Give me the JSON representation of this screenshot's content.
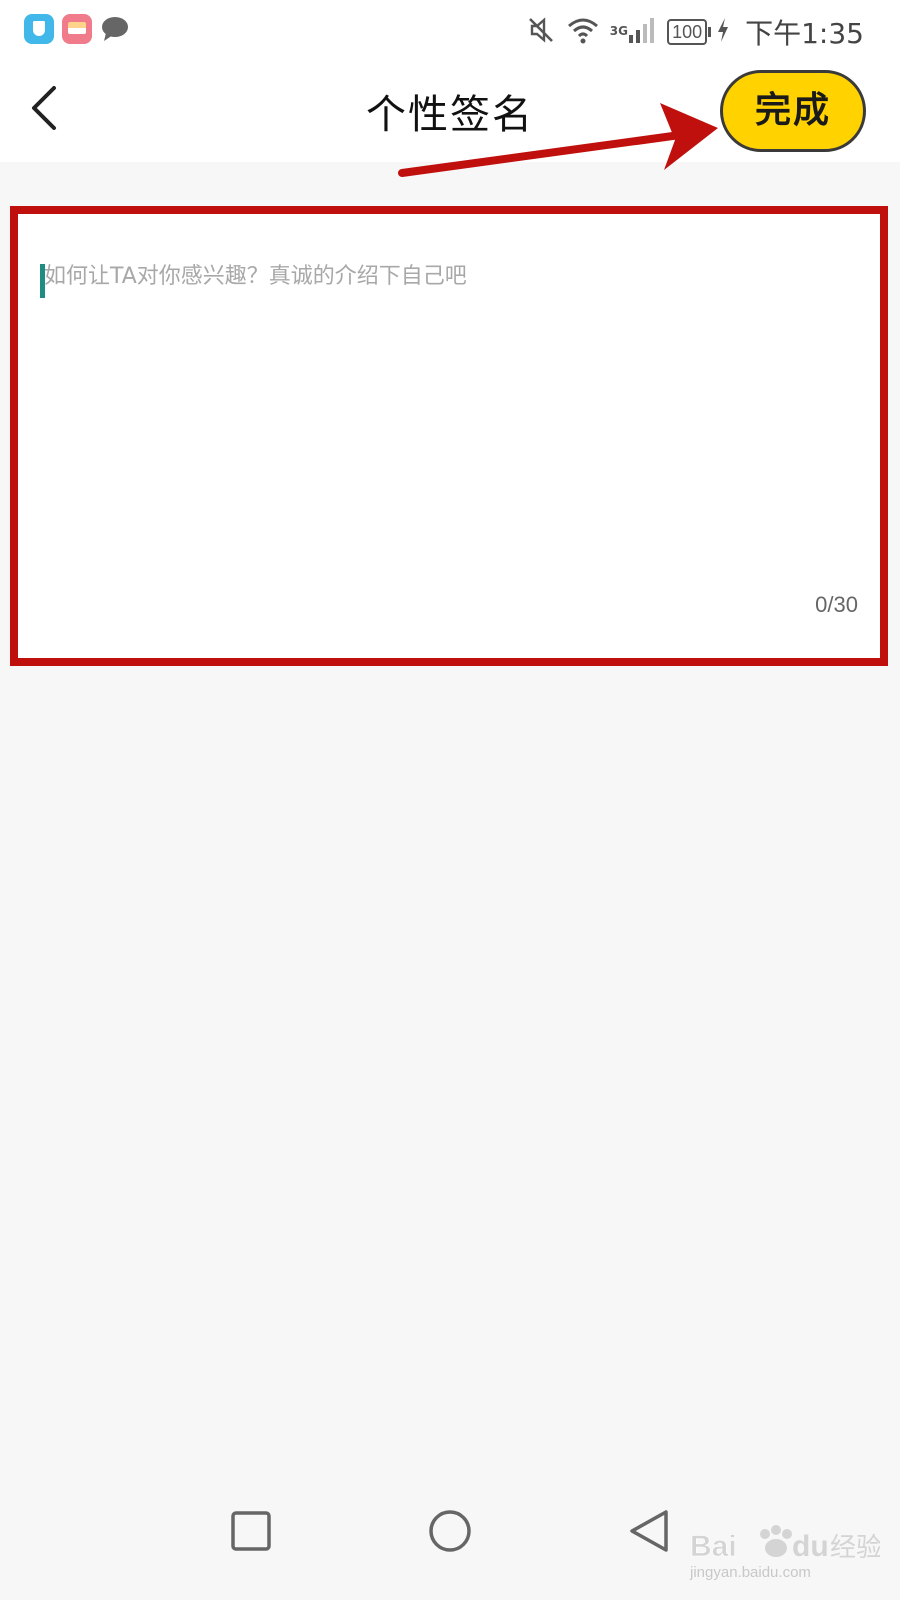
{
  "status_bar": {
    "network_label": "3G",
    "battery_level": "100",
    "time": "下午1:35",
    "icons": [
      "shield-app-icon",
      "gallery-app-icon",
      "chat-bubble-icon",
      "mute-icon",
      "wifi-icon",
      "cellular-signal-icon",
      "battery-icon",
      "charging-icon"
    ]
  },
  "header": {
    "title": "个性签名",
    "done_label": "完成"
  },
  "signature": {
    "placeholder": "如何让TA对你感兴趣？真诚的介绍下自己吧",
    "value": "",
    "counter": "0/30"
  },
  "nav_bar": {
    "buttons": [
      "recents-button",
      "home-button",
      "back-nav-button"
    ]
  },
  "watermark": {
    "brand": "Bai du 经验",
    "url": "jingyan.baidu.com"
  },
  "colors": {
    "accent_yellow": "#ffd200",
    "annotation_red": "#c0100e",
    "caret_teal": "#1e8c82",
    "background": "#f7f7f7"
  }
}
